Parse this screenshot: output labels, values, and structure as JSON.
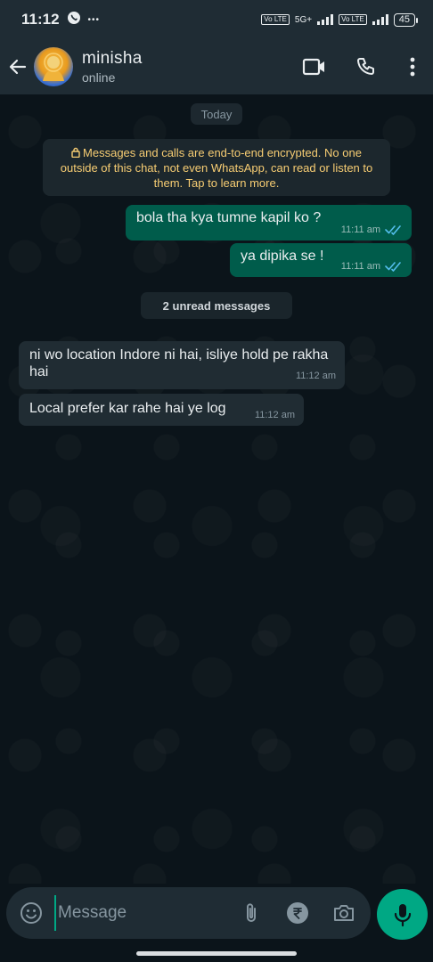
{
  "status_bar": {
    "time": "11:12",
    "more": "•••",
    "network_tag_1": "Vo LTE",
    "network_type": "5G+",
    "network_tag_2": "Vo LTE",
    "battery": "45"
  },
  "header": {
    "contact_name": "minisha",
    "contact_status": "online"
  },
  "chat": {
    "date_chip": "Today",
    "encryption_notice": "Messages and calls are end-to-end encrypted. No one outside of this chat, not even WhatsApp, can read or listen to them. Tap to learn more.",
    "unread_divider": "2 unread messages",
    "messages": [
      {
        "direction": "outgoing",
        "text": "bola tha kya tumne kapil ko ?",
        "time": "11:11 am",
        "status": "read"
      },
      {
        "direction": "outgoing",
        "text": "ya dipika se !",
        "time": "11:11 am",
        "status": "read"
      },
      {
        "direction": "incoming",
        "text": "ni wo location Indore ni hai, isliye hold pe rakha hai",
        "time": "11:12 am"
      },
      {
        "direction": "incoming",
        "text": "Local prefer kar rahe hai ye log",
        "time": "11:12 am"
      }
    ]
  },
  "composer": {
    "placeholder": "Message"
  },
  "colors": {
    "outgoing_bubble": "#005c4b",
    "incoming_bubble": "#202c33",
    "accent": "#00a884",
    "read_ticks": "#53bdeb"
  }
}
